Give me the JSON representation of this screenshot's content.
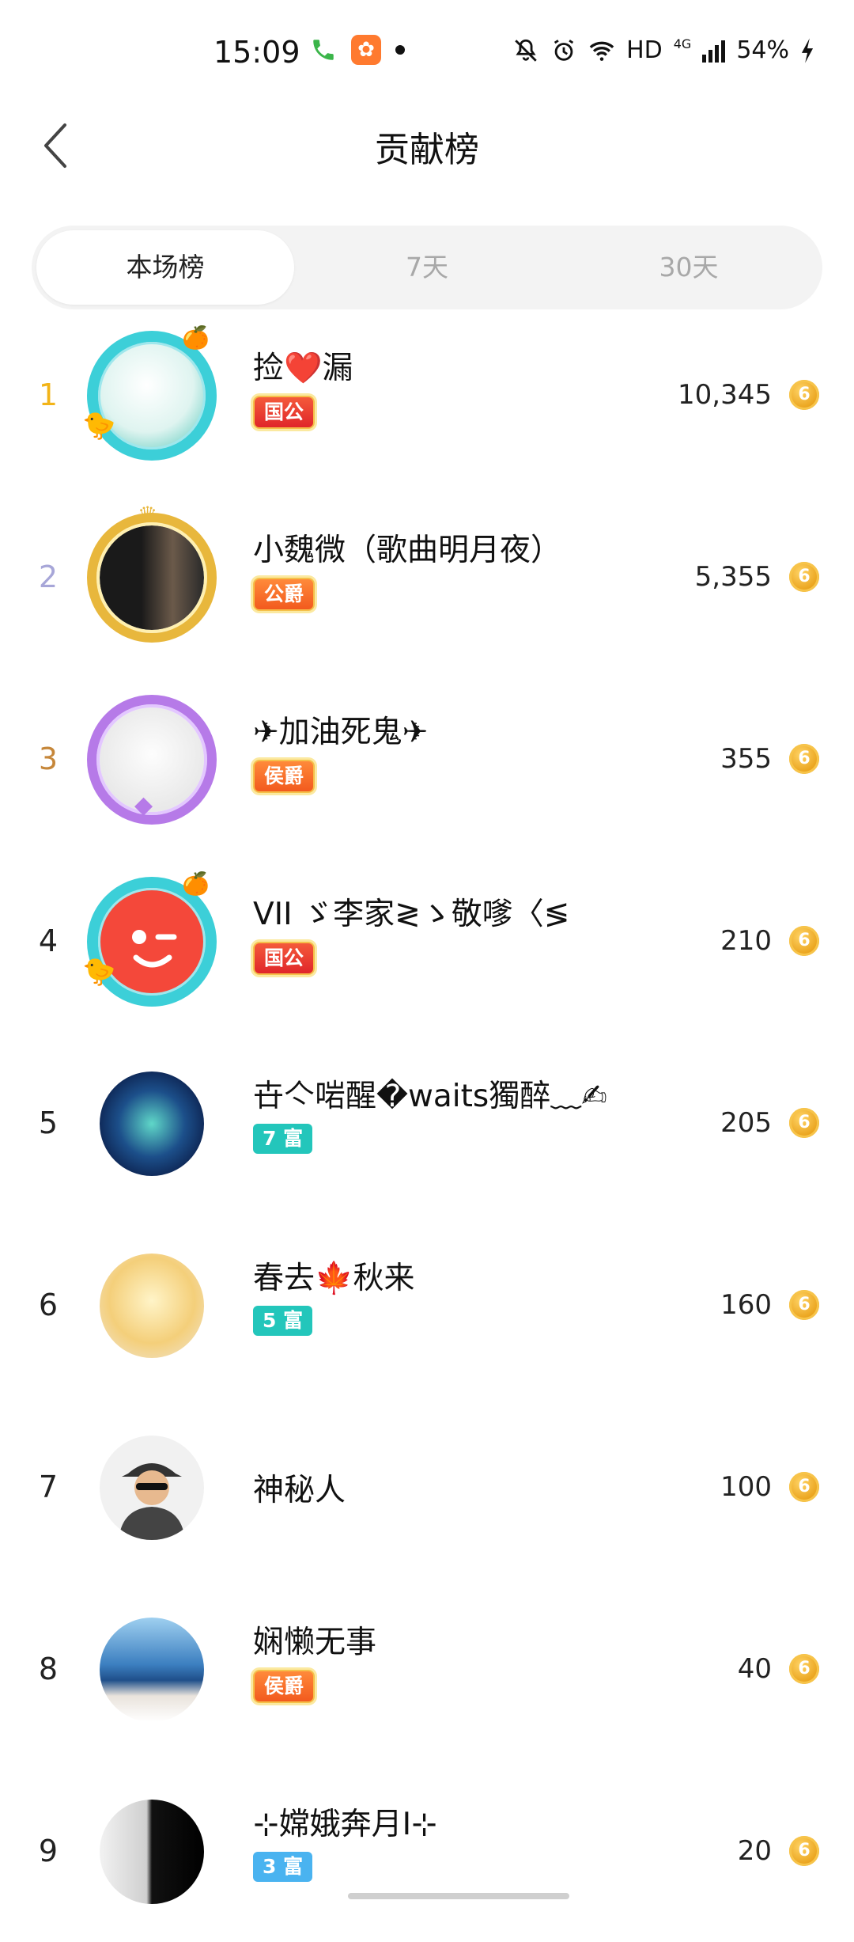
{
  "status_bar": {
    "time": "15:09",
    "phone_icon": "phone-icon",
    "app_icon": "app-notification-icon",
    "net_label": "HD",
    "signal_label": "4G",
    "battery": "54%"
  },
  "header": {
    "title": "贡献榜"
  },
  "tabs": [
    {
      "label": "本场榜",
      "active": true
    },
    {
      "label": "7天",
      "active": false
    },
    {
      "label": "30天",
      "active": false
    }
  ],
  "coin_glyph": "6",
  "rows": [
    {
      "rank": "1",
      "name": "捡❤️漏",
      "badge": "国公",
      "score": "10,345"
    },
    {
      "rank": "2",
      "name": "小魏微（歌曲明月夜）",
      "badge": "公爵",
      "score": "5,355"
    },
    {
      "rank": "3",
      "name": "✈加油死鬼✈",
      "badge": "侯爵",
      "score": "355"
    },
    {
      "rank": "4",
      "name": "VII ゞ李家≷ゝ敬嗲〈≶",
      "badge": "国公",
      "score": "210"
    },
    {
      "rank": "5",
      "name": "卋亽啱醒�waits獨醉﹏✍",
      "badge": "7 富",
      "score": "205"
    },
    {
      "rank": "6",
      "name": "春去🍁秋来",
      "badge": "5 富",
      "score": "160"
    },
    {
      "rank": "7",
      "name": "神秘人",
      "badge": "",
      "score": "100"
    },
    {
      "rank": "8",
      "name": "娴懒无事",
      "badge": "侯爵",
      "score": "40"
    },
    {
      "rank": "9",
      "name": "⊹嫦娥奔月I⊹",
      "badge": "3 富",
      "score": "20"
    }
  ]
}
